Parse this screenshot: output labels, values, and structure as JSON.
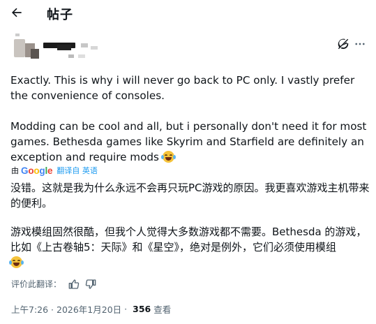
{
  "header": {
    "back_icon": "arrow-left-icon",
    "title": "帖子"
  },
  "post": {
    "original_paragraphs": [
      "Exactly. This is why i will never go back to PC only. I vastly prefer the convenience of consoles.",
      "Modding can be cool and all, but i personally don't need it for most games. Bethesda games like Skyrim and Starfield are definitely an exception and require mods"
    ],
    "emoji": "tears-of-joy-emoji",
    "translation": {
      "by": "由",
      "provider_letters": [
        "G",
        "o",
        "o",
        "g",
        "l",
        "e"
      ],
      "from_label": "翻译自 英语"
    },
    "translated_paragraphs": [
      "没错。这就是我为什么永远不会再只玩PC游戏的原因。我更喜欢游戏主机带来的便利。",
      "游戏模组固然很酷，但我个人觉得大多数游戏都不需要。Bethesda 的游戏，比如《上古卷轴5：天际》和《星空》，绝对是例外，它们必须使用模组"
    ],
    "rate_label": "评价此翻译：",
    "time": "上午7:26 · 2026年1月20日",
    "separator": "·",
    "views": "356",
    "views_label": "查看"
  },
  "colors": {
    "text": "#0f1419",
    "secondary": "#536471",
    "link": "#1d9bf0",
    "google_blue": "#4285f4",
    "google_red": "#ea4335",
    "google_yellow": "#fbbc05",
    "google_green": "#34a853"
  }
}
